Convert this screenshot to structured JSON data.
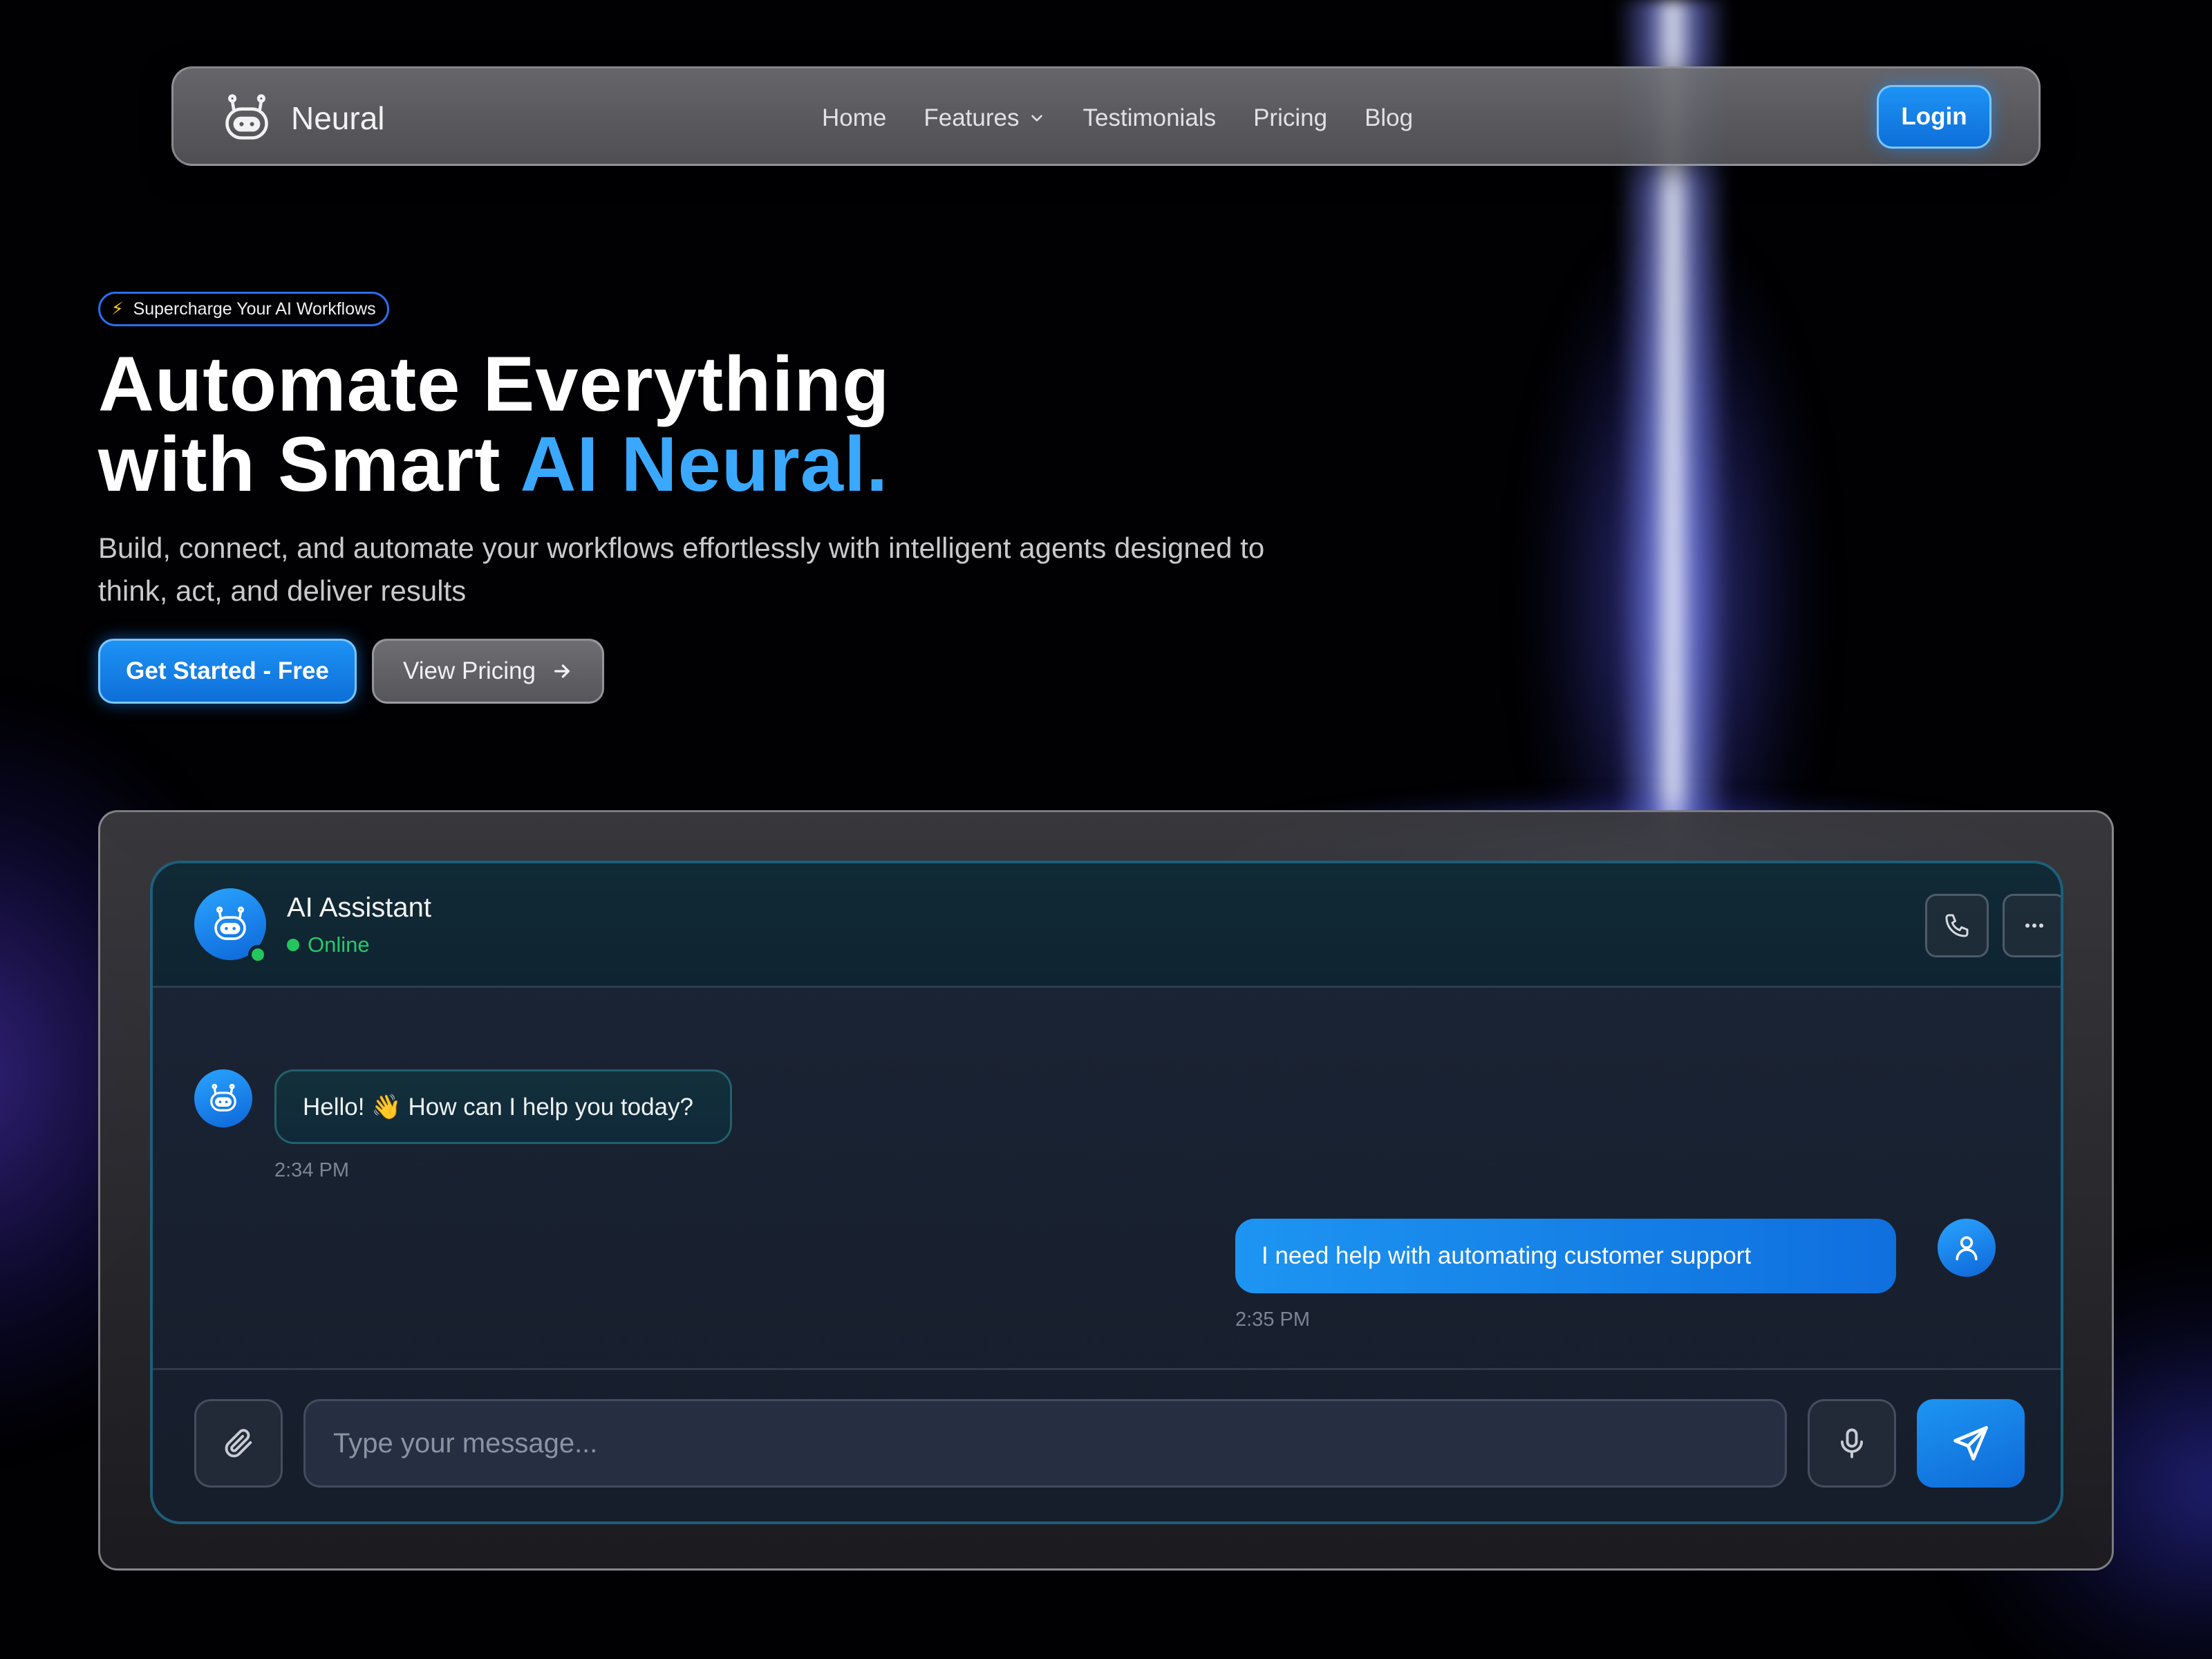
{
  "brand": {
    "name": "Neural",
    "icon": "robot-icon"
  },
  "nav": {
    "links": [
      "Home",
      "Features",
      "Testimonials",
      "Pricing",
      "Blog"
    ],
    "login": "Login"
  },
  "hero": {
    "badge": "Supercharge Your AI Workflows",
    "title_line1": "Automate Everything",
    "title_line2": "with Smart ",
    "title_accent": "AI Neural.",
    "subtitle": "Build, connect, and automate your workflows effortlessly with intelligent agents designed to think, act, and deliver results",
    "cta_primary": "Get Started - Free",
    "cta_secondary": "View Pricing"
  },
  "chat": {
    "assistant_name": "AI Assistant",
    "status": "Online",
    "messages": [
      {
        "from": "bot",
        "text": "Hello! 👋 How can I help you today?",
        "time": "2:34 PM"
      },
      {
        "from": "user",
        "text": "I need help with automating customer support",
        "time": "2:35 PM"
      }
    ],
    "input_placeholder": "Type your message..."
  },
  "colors": {
    "accent": "#1d92f5",
    "accent_text": "#3aa8ff",
    "online": "#22c55e",
    "beam": "#8a90ff"
  }
}
